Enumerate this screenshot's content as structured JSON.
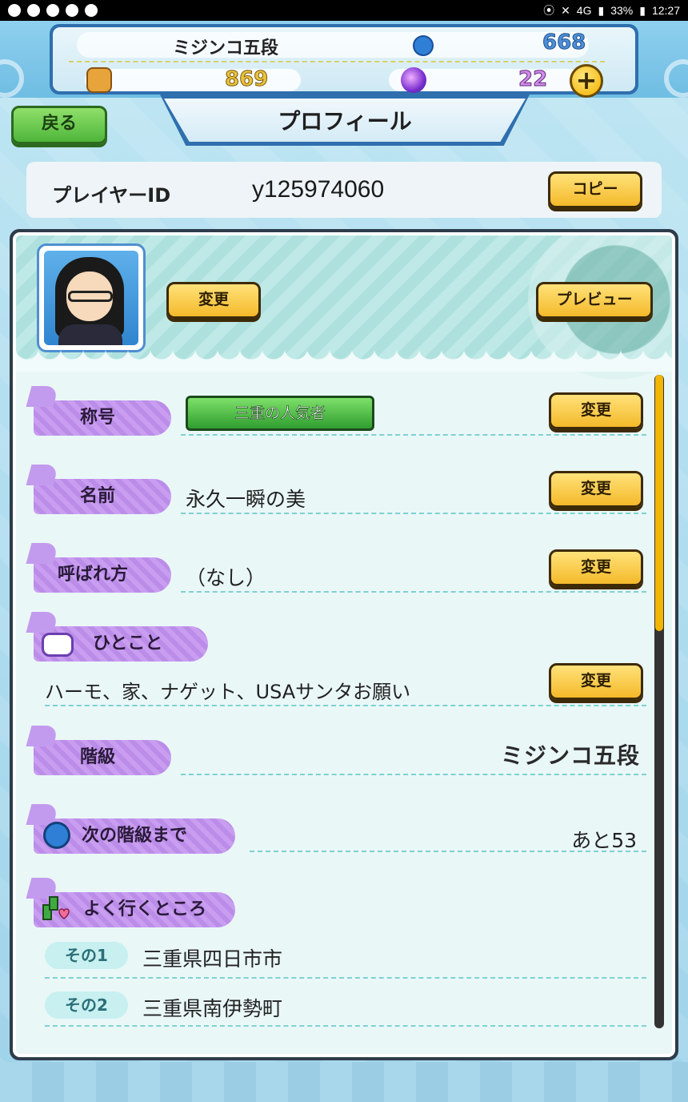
{
  "status_bar": {
    "battery": "33%",
    "time": "12:27",
    "network": "4G"
  },
  "header": {
    "rank_name": "ミジンコ五段",
    "xp_value": "668",
    "money_value": "869",
    "orb_value": "22",
    "plus_label": "+"
  },
  "nav": {
    "back_label": "戻る",
    "title": "プロフィール"
  },
  "player_id": {
    "label": "プレイヤーID",
    "value": "y125974060",
    "copy_label": "コピー"
  },
  "profile": {
    "avatar_change_label": "変更",
    "preview_label": "プレビュー",
    "rows": [
      {
        "label": "称号",
        "value": "三重の人気者",
        "button": "変更"
      },
      {
        "label": "名前",
        "value": "永久一瞬の美",
        "button": "変更"
      },
      {
        "label": "呼ばれ方",
        "value": "（なし）",
        "button": "変更"
      },
      {
        "label": "ひとこと",
        "value": "ハーモ、家、ナゲット、USAサンタお願い",
        "button": "変更"
      },
      {
        "label": "階級",
        "value": "ミジンコ五段"
      },
      {
        "label": "次の階級まで",
        "value": "あと53"
      },
      {
        "label": "よく行くところ"
      }
    ],
    "places": [
      {
        "tag": "その1",
        "name": "三重県四日市市"
      },
      {
        "tag": "その2",
        "name": "三重県南伊勢町"
      }
    ]
  },
  "colors": {
    "accent_gold": "#f4b92a",
    "label_purple": "#c99ef0",
    "back_green": "#4fb53a",
    "frame_blue": "#2f6fae"
  }
}
